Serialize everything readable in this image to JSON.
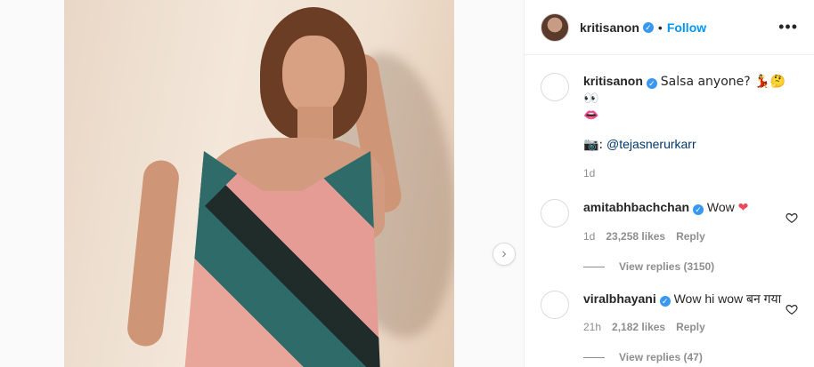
{
  "post": {
    "author": "kritisanon",
    "follow_label": "Follow",
    "dot": "•",
    "more_label": "•••"
  },
  "caption": {
    "username": "kritisanon",
    "text": "Salsa anyone? 💃🤔👀",
    "text2": "👄",
    "credit_icon": "📷:",
    "credit_mention": "@tejasnerurkarr",
    "time": "1d"
  },
  "comments": [
    {
      "username": "amitabhbachchan",
      "text": "Wow",
      "emoji": "❤",
      "time": "1d",
      "likes": "23,258 likes",
      "reply": "Reply",
      "view_replies": "View replies (3150)"
    },
    {
      "username": "viralbhayani",
      "text": "Wow hi wow बन गया",
      "time": "21h",
      "likes": "2,182 likes",
      "reply": "Reply",
      "view_replies": "View replies (47)"
    }
  ],
  "icons": {
    "next": "chevron-right-icon",
    "heart": "heart-icon",
    "verified": "verified-badge-icon"
  },
  "colors": {
    "link": "#0095f6",
    "verified": "#3897f0",
    "secondary_text": "#8e8e8e"
  }
}
